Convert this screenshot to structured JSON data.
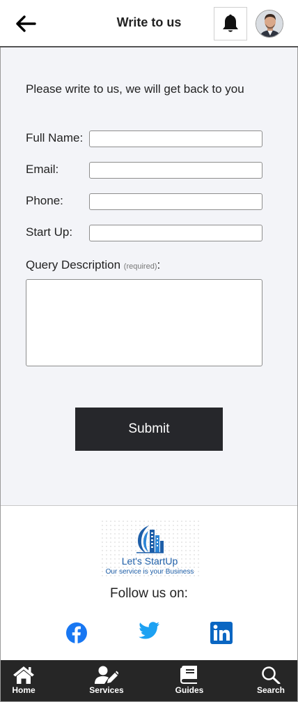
{
  "header": {
    "title": "Write to us"
  },
  "form": {
    "intro": "Please write to us, we will get back to you",
    "fields": [
      {
        "label": "Full Name:",
        "value": ""
      },
      {
        "label": "Email:",
        "value": ""
      },
      {
        "label": "Phone:",
        "value": ""
      },
      {
        "label": "Start Up:",
        "value": ""
      }
    ],
    "query_label": "Query Description",
    "query_required": "(required)",
    "query_colon": ":",
    "query_value": "",
    "submit_label": "Submit"
  },
  "footer": {
    "logo_name": "Let's StartUp",
    "logo_tagline": "Our service is your Business",
    "follow_text": "Follow us on:",
    "social": [
      "facebook-icon",
      "twitter-icon",
      "linkedin-icon"
    ]
  },
  "nav": {
    "items": [
      {
        "label": "Home",
        "icon": "home-icon"
      },
      {
        "label": "Services",
        "icon": "services-icon"
      },
      {
        "label": "Guides",
        "icon": "guides-icon"
      },
      {
        "label": "Search",
        "icon": "search-icon"
      }
    ]
  },
  "colors": {
    "nav_bg": "#262626",
    "submit_bg": "#26272b",
    "form_bg": "#f3f4f8",
    "brand_blue": "#1d5ea8",
    "facebook": "#1877f2",
    "twitter": "#1da1f2",
    "linkedin": "#0a66c2"
  }
}
